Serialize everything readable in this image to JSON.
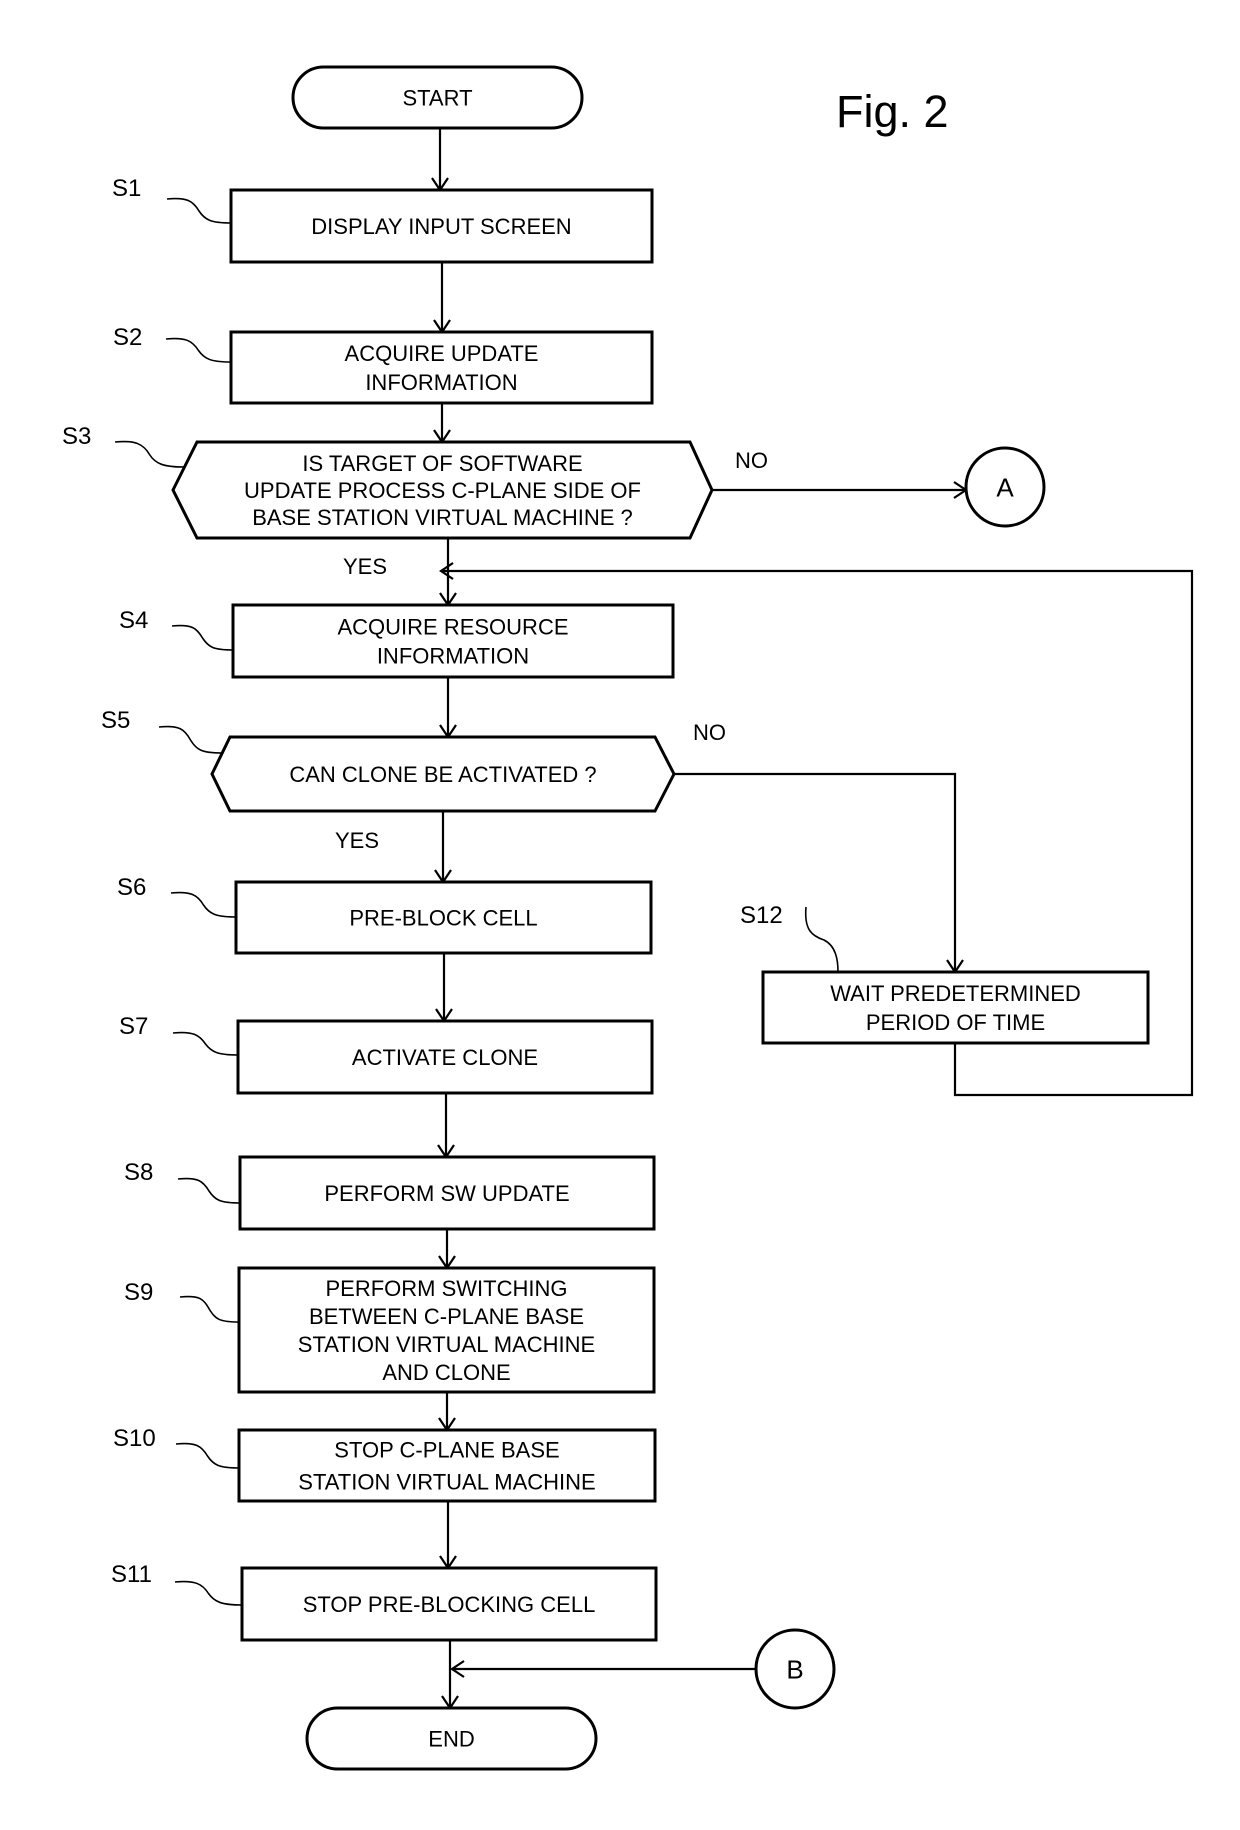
{
  "figure": {
    "title": "Fig. 2"
  },
  "nodes": {
    "start": {
      "type": "terminal",
      "lines": [
        "START"
      ]
    },
    "s1": {
      "type": "process",
      "step": "S1",
      "lines": [
        "DISPLAY INPUT SCREEN"
      ]
    },
    "s2": {
      "type": "process",
      "step": "S2",
      "lines": [
        "ACQUIRE UPDATE",
        "INFORMATION"
      ]
    },
    "s3": {
      "type": "decision",
      "step": "S3",
      "lines": [
        "IS TARGET OF SOFTWARE",
        "UPDATE PROCESS C-PLANE SIDE OF",
        "BASE STATION VIRTUAL MACHINE ?"
      ]
    },
    "s4": {
      "type": "process",
      "step": "S4",
      "lines": [
        "ACQUIRE RESOURCE",
        "INFORMATION"
      ]
    },
    "s5": {
      "type": "decision",
      "step": "S5",
      "lines": [
        "CAN CLONE BE ACTIVATED ?"
      ]
    },
    "s6": {
      "type": "process",
      "step": "S6",
      "lines": [
        "PRE-BLOCK CELL"
      ]
    },
    "s7": {
      "type": "process",
      "step": "S7",
      "lines": [
        "ACTIVATE CLONE"
      ]
    },
    "s8": {
      "type": "process",
      "step": "S8",
      "lines": [
        "PERFORM SW UPDATE"
      ]
    },
    "s9": {
      "type": "process",
      "step": "S9",
      "lines": [
        "PERFORM SWITCHING",
        "BETWEEN C-PLANE BASE",
        "STATION VIRTUAL MACHINE",
        "AND CLONE"
      ]
    },
    "s10": {
      "type": "process",
      "step": "S10",
      "lines": [
        "STOP C-PLANE BASE",
        "STATION VIRTUAL MACHINE"
      ]
    },
    "s11": {
      "type": "process",
      "step": "S11",
      "lines": [
        "STOP PRE-BLOCKING CELL"
      ]
    },
    "s12": {
      "type": "process",
      "step": "S12",
      "lines": [
        "WAIT PREDETERMINED",
        "PERIOD OF TIME"
      ]
    },
    "end": {
      "type": "terminal",
      "lines": [
        "END"
      ]
    },
    "conA": {
      "type": "connector",
      "lines": [
        "A"
      ]
    },
    "conB": {
      "type": "connector",
      "lines": [
        "B"
      ]
    }
  },
  "edges": [
    {
      "from": "start",
      "to": "s1",
      "label": ""
    },
    {
      "from": "s1",
      "to": "s2",
      "label": ""
    },
    {
      "from": "s2",
      "to": "s3",
      "label": ""
    },
    {
      "from": "s3",
      "to": "s4",
      "label": "YES"
    },
    {
      "from": "s3",
      "to": "conA",
      "label": "NO"
    },
    {
      "from": "s4",
      "to": "s5",
      "label": ""
    },
    {
      "from": "s5",
      "to": "s6",
      "label": "YES"
    },
    {
      "from": "s5",
      "to": "s12",
      "label": "NO"
    },
    {
      "from": "s12",
      "to": "s4",
      "label": ""
    },
    {
      "from": "s6",
      "to": "s7",
      "label": ""
    },
    {
      "from": "s7",
      "to": "s8",
      "label": ""
    },
    {
      "from": "s8",
      "to": "s9",
      "label": ""
    },
    {
      "from": "s9",
      "to": "s10",
      "label": ""
    },
    {
      "from": "s10",
      "to": "s11",
      "label": ""
    },
    {
      "from": "s11",
      "to": "end",
      "label": ""
    },
    {
      "from": "conB",
      "to": "end",
      "label": ""
    }
  ]
}
